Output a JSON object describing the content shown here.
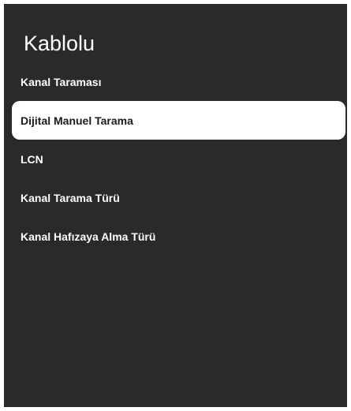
{
  "header": {
    "title": "Kablolu"
  },
  "menu": {
    "items": [
      {
        "label": "Kanal Taraması",
        "selected": false
      },
      {
        "label": "Dijital Manuel Tarama",
        "selected": true
      },
      {
        "label": "LCN",
        "selected": false
      },
      {
        "label": "Kanal Tarama Türü",
        "selected": false
      },
      {
        "label": "Kanal Hafızaya Alma Türü",
        "selected": false
      }
    ]
  },
  "colors": {
    "panel_background": "#2a2a2a",
    "text": "#ffffff",
    "selected_background": "#ffffff",
    "selected_text": "#1a1a1a"
  }
}
